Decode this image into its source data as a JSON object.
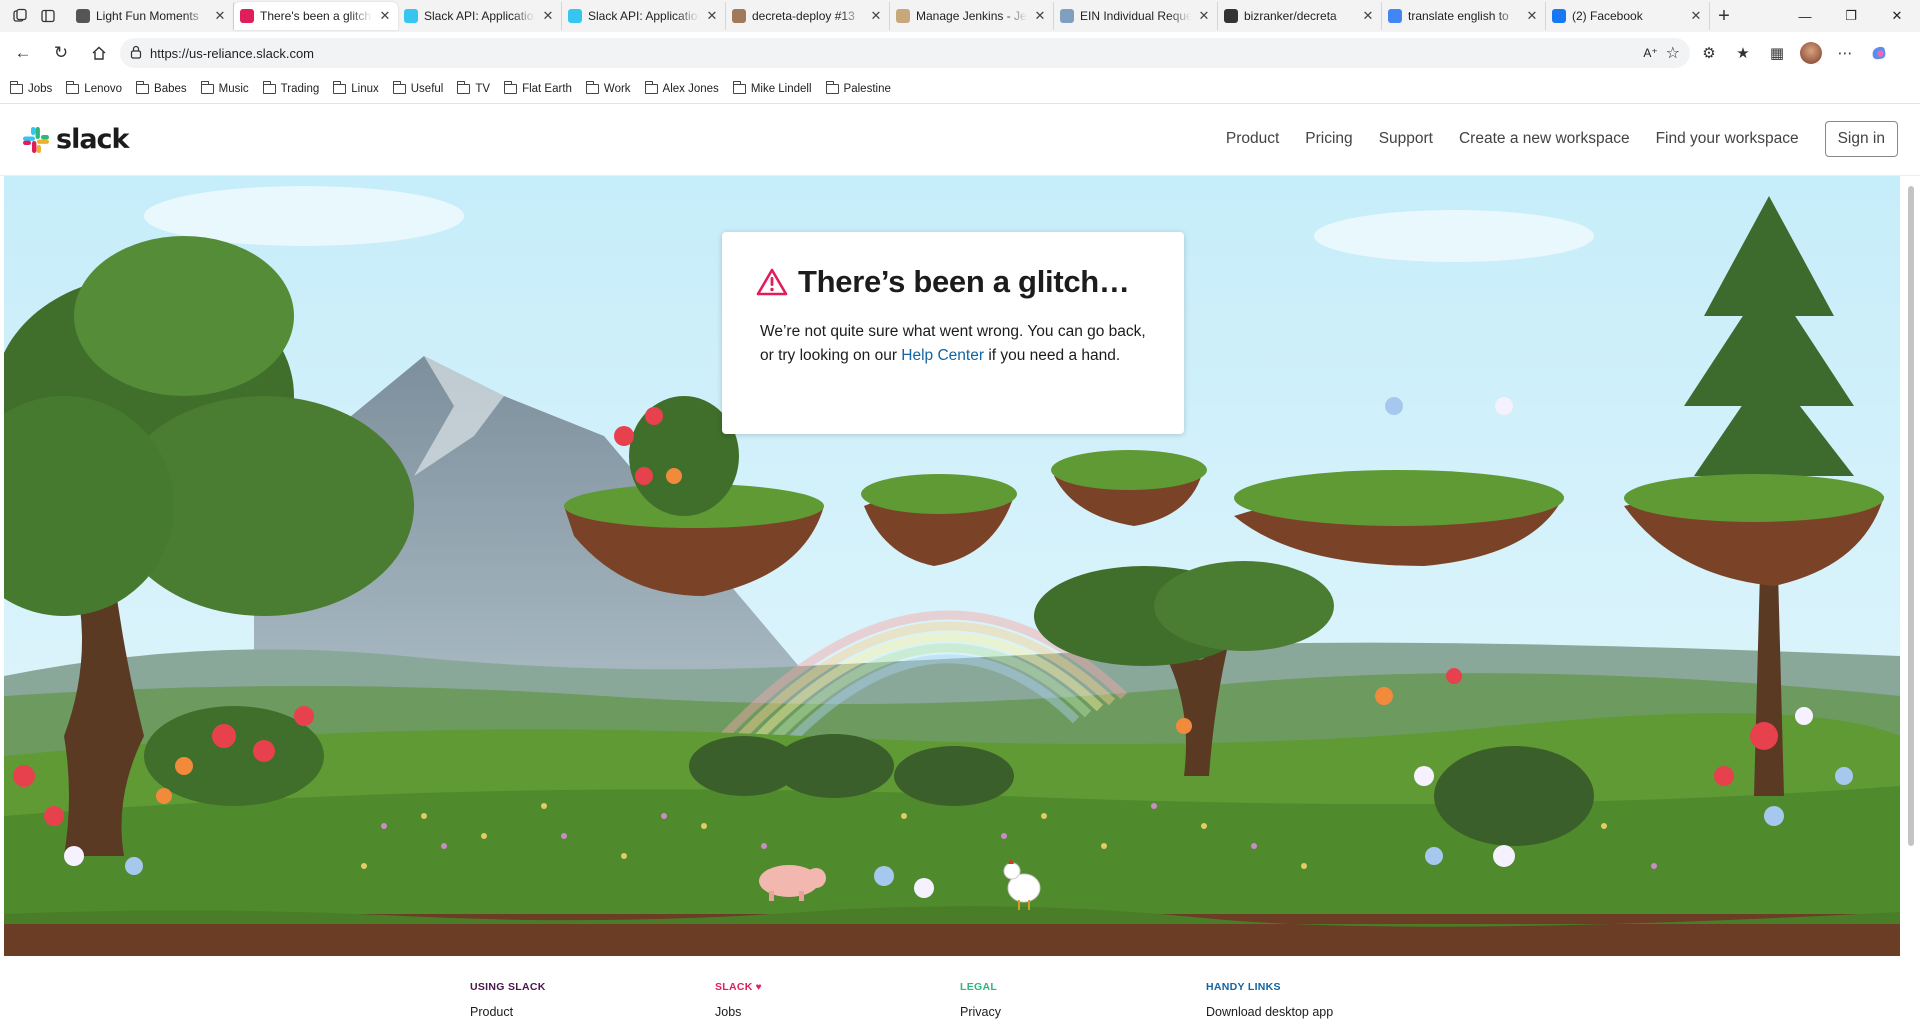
{
  "browser": {
    "tabs": [
      {
        "title": "Light Fun Moments",
        "favicon_color": "#555555",
        "active": false
      },
      {
        "title": "There's been a glitch…",
        "favicon_color": "#e01e5a",
        "active": true
      },
      {
        "title": "Slack API: Applications",
        "favicon_color": "#36c5f0",
        "active": false
      },
      {
        "title": "Slack API: Applications",
        "favicon_color": "#36c5f0",
        "active": false
      },
      {
        "title": "decreta-deploy #13",
        "favicon_color": "#a0785a",
        "active": false
      },
      {
        "title": "Manage Jenkins - Jenkins",
        "favicon_color": "#c8a87a",
        "active": false
      },
      {
        "title": "EIN Individual Request",
        "favicon_color": "#7f9fbf",
        "active": false
      },
      {
        "title": "bizranker/decreta",
        "favicon_color": "#333333",
        "active": false
      },
      {
        "title": "translate english to",
        "favicon_color": "#4285f4",
        "active": false
      },
      {
        "title": "(2) Facebook",
        "favicon_color": "#1877f2",
        "active": false
      }
    ],
    "url": "https://us-reliance.slack.com",
    "bookmarks": [
      "Jobs",
      "Lenovo",
      "Babes",
      "Music",
      "Trading",
      "Linux",
      "Useful",
      "TV",
      "Flat Earth",
      "Work",
      "Alex Jones",
      "Mike Lindell",
      "Palestine"
    ]
  },
  "header": {
    "logo_text": "slack",
    "nav": [
      "Product",
      "Pricing",
      "Support",
      "Create a new workspace",
      "Find your workspace"
    ],
    "signin": "Sign in"
  },
  "error": {
    "title": "There’s been a glitch…",
    "body_before": "We’re not quite sure what went wrong. You can go back, or try looking on our ",
    "link": "Help Center",
    "body_after": " if you need a hand."
  },
  "footer": {
    "columns": [
      {
        "heading": "USING SLACK",
        "color": "#4a154b",
        "first_link": "Product"
      },
      {
        "heading": "SLACK",
        "color": "#e01e5a",
        "first_link": "Jobs"
      },
      {
        "heading": "LEGAL",
        "color": "#2eb67d",
        "first_link": "Privacy"
      },
      {
        "heading": "HANDY LINKS",
        "color": "#1264a3",
        "first_link": "Download desktop app"
      }
    ]
  },
  "colors": {
    "slack_blue": "#36c5f0",
    "slack_green": "#2eb67d",
    "slack_yellow": "#ecb22e",
    "slack_red": "#e01e5a",
    "link": "#1264a3",
    "warning": "#e01e5a"
  }
}
